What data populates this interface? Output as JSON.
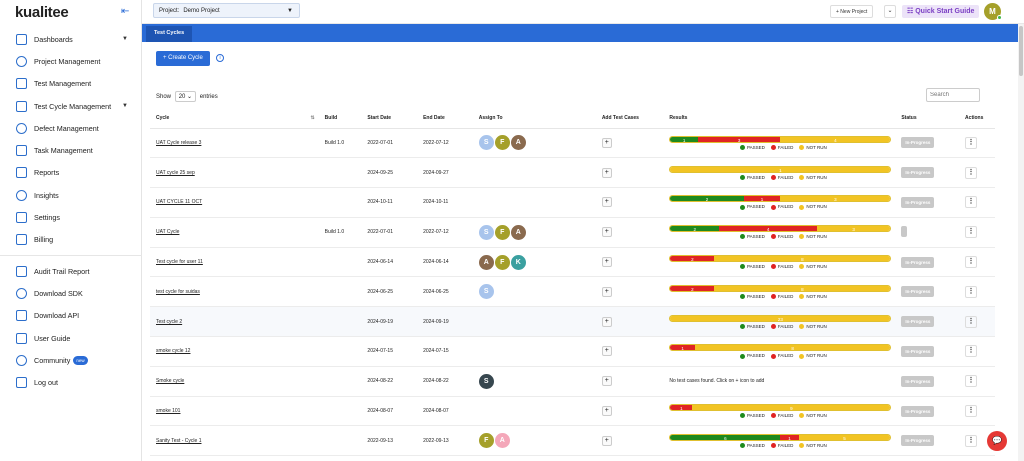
{
  "brand": {
    "logo": "kualitee"
  },
  "sidebar": {
    "items": [
      {
        "label": "Dashboards",
        "caret": true
      },
      {
        "label": "Project Management"
      },
      {
        "label": "Test Management"
      },
      {
        "label": "Test Cycle Management",
        "caret": true
      },
      {
        "label": "Defect Management"
      },
      {
        "label": "Task Management"
      },
      {
        "label": "Reports"
      },
      {
        "label": "Insights"
      },
      {
        "label": "Settings"
      },
      {
        "label": "Billing"
      }
    ],
    "bottom": [
      {
        "label": "Audit Trail Report"
      },
      {
        "label": "Download SDK"
      },
      {
        "label": "Download API"
      },
      {
        "label": "User Guide"
      },
      {
        "label": "Community",
        "badge": "new"
      },
      {
        "label": "Log out"
      }
    ]
  },
  "topbar": {
    "project_label": "Project:",
    "project_value": "Demo Project",
    "new_project": "+ New Project",
    "quick_start": "Quick Start Guide",
    "avatar": "M"
  },
  "tabs": {
    "active": "Test Cycles"
  },
  "toolbar": {
    "create": "+ Create Cycle",
    "show": "Show",
    "entries_value": "20",
    "entries": "entries",
    "search_placeholder": "Search"
  },
  "table": {
    "headers": [
      "Cycle",
      "Build",
      "Start Date",
      "End Date",
      "Assign To",
      "Add Test Cases",
      "Results",
      "Status",
      "Actions"
    ],
    "legend": {
      "passed": "PASSED",
      "failed": "FAILED",
      "not_run": "NOT RUN"
    },
    "colors": {
      "passed": "#1e8a1e",
      "failed": "#e02424",
      "not_run": "#f2c424"
    },
    "rows": [
      {
        "cycle": "UAT Cycle release 3",
        "build": "Build 1.0",
        "start": "2022-07-01",
        "end": "2022-07-12",
        "assignees": [
          {
            "l": "S",
            "c": "#a8c4ec"
          },
          {
            "l": "F",
            "c": "#a5a02a"
          },
          {
            "l": "A",
            "c": "#8a6a4e"
          }
        ],
        "results": {
          "passed": 1,
          "failed": 3,
          "not_run": 4
        },
        "status": "In-Progress"
      },
      {
        "cycle": "UAT cycle 25 sep",
        "build": "",
        "start": "2024-09-25",
        "end": "2024-09-27",
        "assignees": [],
        "results": {
          "passed": 0,
          "failed": 0,
          "not_run": 1
        },
        "status": "In-Progress"
      },
      {
        "cycle": "UAT CYCLE 11 OCT",
        "build": "",
        "start": "2024-10-11",
        "end": "2024-10-11",
        "assignees": [],
        "results": {
          "passed": 2,
          "failed": 1,
          "not_run": 3
        },
        "status": "In-Progress"
      },
      {
        "cycle": "UAT Cycle",
        "build": "Build 1.0",
        "start": "2022-07-01",
        "end": "2022-07-12",
        "assignees": [
          {
            "l": "S",
            "c": "#a8c4ec"
          },
          {
            "l": "F",
            "c": "#a5a02a"
          },
          {
            "l": "A",
            "c": "#8a6a4e"
          }
        ],
        "results": {
          "passed": 2,
          "failed": 4,
          "not_run": 3
        },
        "status": ""
      },
      {
        "cycle": "Test cycle for user 11",
        "build": "",
        "start": "2024-06-14",
        "end": "2024-06-14",
        "assignees": [
          {
            "l": "A",
            "c": "#8a6a4e"
          },
          {
            "l": "F",
            "c": "#a5a02a"
          },
          {
            "l": "K",
            "c": "#3aa0a0"
          }
        ],
        "results": {
          "passed": 0,
          "failed": 2,
          "not_run": 8
        },
        "status": "In-Progress"
      },
      {
        "cycle": "test cycle for suidas",
        "build": "",
        "start": "2024-06-25",
        "end": "2024-06-25",
        "assignees": [
          {
            "l": "S",
            "c": "#a8c4ec"
          }
        ],
        "results": {
          "passed": 0,
          "failed": 2,
          "not_run": 8
        },
        "status": "In-Progress"
      },
      {
        "cycle": "Test cycle 2",
        "build": "",
        "start": "2024-09-19",
        "end": "2024-09-19",
        "assignees": [],
        "results": {
          "passed": 0,
          "failed": 0,
          "not_run": 23
        },
        "status": "In-Progress"
      },
      {
        "cycle": "smoke cycle 12",
        "build": "",
        "start": "2024-07-15",
        "end": "2024-07-15",
        "assignees": [],
        "results": {
          "passed": 0,
          "failed": 1,
          "not_run": 8
        },
        "status": "In-Progress"
      },
      {
        "cycle": "Smoke cycle",
        "build": "",
        "start": "2024-08-22",
        "end": "2024-08-22",
        "assignees": [
          {
            "l": "S",
            "c": "#37474f"
          }
        ],
        "results": null,
        "no_cases": "No test cases found. Click on + icon to add",
        "status": "In-Progress"
      },
      {
        "cycle": "smoke 101",
        "build": "",
        "start": "2024-08-07",
        "end": "2024-08-07",
        "assignees": [],
        "results": {
          "passed": 0,
          "failed": 1,
          "not_run": 9
        },
        "status": "In-Progress"
      },
      {
        "cycle": "Sanity Test - Cycle 1",
        "build": "",
        "start": "2022-09-13",
        "end": "2022-09-13",
        "assignees": [
          {
            "l": "F",
            "c": "#a5a02a"
          },
          {
            "l": "A",
            "c": "#f4a7b9"
          }
        ],
        "results": {
          "passed": 6,
          "failed": 1,
          "not_run": 5
        },
        "status": "In-Progress"
      }
    ]
  }
}
